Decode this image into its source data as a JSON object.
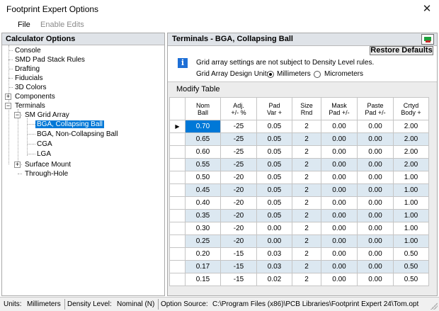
{
  "window": {
    "title": "Footprint Expert Options",
    "close_glyph": "✕"
  },
  "menu": {
    "file": "File",
    "enable_edits": "Enable Edits"
  },
  "left_panel": {
    "header": "Calculator Options",
    "tree": {
      "console": "Console",
      "smd_pad_stack_rules": "SMD Pad Stack Rules",
      "drafting": "Drafting",
      "fiducials": "Fiducials",
      "3d_colors": "3D Colors",
      "components": "Components",
      "terminals": "Terminals",
      "sm_grid_array": "SM Grid Array",
      "bga_collapsing_ball": "BGA, Collapsing Ball",
      "bga_non_collapsing_ball": "BGA, Non-Collapsing Ball",
      "cga": "CGA",
      "lga": "LGA",
      "surface_mount": "Surface Mount",
      "through_hole": "Through-Hole"
    },
    "expander_plus": "+",
    "expander_minus": "−"
  },
  "right_panel": {
    "header": "Terminals - BGA, Collapsing Ball",
    "restore_defaults": "Restore Defaults",
    "info_icon": "i",
    "info_text": "Grid array settings are not subject to Density Level rules.",
    "units_label": "Grid Array Design Units",
    "units_options": {
      "millimeters": "Millimeters",
      "micrometers": "Micrometers"
    },
    "units_selected": "Millimeters",
    "modify_table_label": "Modify Table",
    "row_pointer_glyph": "▶",
    "table": {
      "headers": {
        "nom_ball": [
          "Nom",
          "Ball"
        ],
        "adj": [
          "Adj.",
          "+/- %"
        ],
        "pad_var": [
          "Pad",
          "Var +"
        ],
        "size_rnd": [
          "Size",
          "Rnd"
        ],
        "mask_pad": [
          "Mask",
          "Pad +/-"
        ],
        "paste_pad": [
          "Paste",
          "Pad +/-"
        ],
        "crtyd_body": [
          "Crtyd",
          "Body +"
        ]
      },
      "rows": [
        [
          "0.70",
          "-25",
          "0.05",
          "2",
          "0.00",
          "0.00",
          "2.00"
        ],
        [
          "0.65",
          "-25",
          "0.05",
          "2",
          "0.00",
          "0.00",
          "2.00"
        ],
        [
          "0.60",
          "-25",
          "0.05",
          "2",
          "0.00",
          "0.00",
          "2.00"
        ],
        [
          "0.55",
          "-25",
          "0.05",
          "2",
          "0.00",
          "0.00",
          "2.00"
        ],
        [
          "0.50",
          "-20",
          "0.05",
          "2",
          "0.00",
          "0.00",
          "1.00"
        ],
        [
          "0.45",
          "-20",
          "0.05",
          "2",
          "0.00",
          "0.00",
          "1.00"
        ],
        [
          "0.40",
          "-20",
          "0.05",
          "2",
          "0.00",
          "0.00",
          "1.00"
        ],
        [
          "0.35",
          "-20",
          "0.05",
          "2",
          "0.00",
          "0.00",
          "1.00"
        ],
        [
          "0.30",
          "-20",
          "0.00",
          "2",
          "0.00",
          "0.00",
          "1.00"
        ],
        [
          "0.25",
          "-20",
          "0.00",
          "2",
          "0.00",
          "0.00",
          "1.00"
        ],
        [
          "0.20",
          "-15",
          "0.03",
          "2",
          "0.00",
          "0.00",
          "0.50"
        ],
        [
          "0.17",
          "-15",
          "0.03",
          "2",
          "0.00",
          "0.00",
          "0.50"
        ],
        [
          "0.15",
          "-15",
          "0.02",
          "2",
          "0.00",
          "0.00",
          "0.50"
        ]
      ]
    }
  },
  "statusbar": {
    "units_label": "Units:",
    "units_value": "Millimeters",
    "density_label": "Density Level:",
    "density_value": "Nominal (N)",
    "option_source_label": "Option Source:",
    "option_source_value": "C:\\Program Files (x86)\\PCB Libraries\\Footprint Expert 24\\Tom.opt"
  },
  "colors": {
    "selection": "#0078d7",
    "alt_row": "#dce8f1",
    "panel_header": "#dfe3e8",
    "info_icon": "#1e6fd6"
  }
}
